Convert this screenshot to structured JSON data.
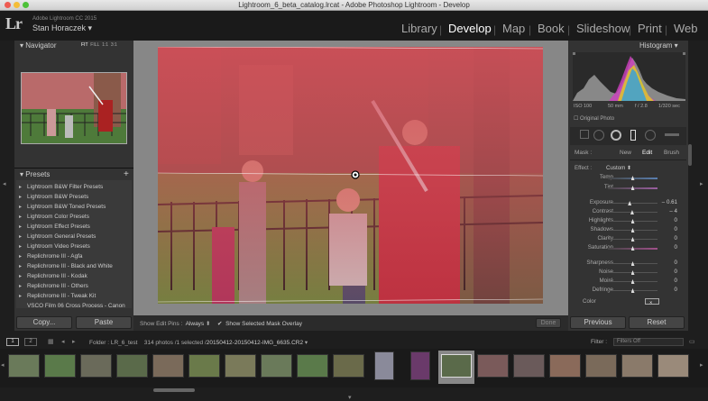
{
  "window": {
    "title": "Lightroom_6_beta_catalog.lrcat - Adobe Photoshop Lightroom - Develop"
  },
  "identity": {
    "app": "Adobe Lightroom CC 2015",
    "user": "Stan Horaczek",
    "logo": "Lr"
  },
  "modules": [
    "Library",
    "Develop",
    "Map",
    "Book",
    "Slideshow",
    "Print",
    "Web"
  ],
  "active_module": "Develop",
  "navigator": {
    "title": "Navigator",
    "zoom": [
      "FIT",
      "FILL",
      "1:1",
      "3:1"
    ]
  },
  "presets": {
    "title": "Presets",
    "add": "+",
    "items": [
      "Lightroom B&W Filter Presets",
      "Lightroom B&W Presets",
      "Lightroom B&W Toned Presets",
      "Lightroom Color Presets",
      "Lightroom Effect Presets",
      "Lightroom General Presets",
      "Lightroom Video Presets",
      "Replichrome III - Agfa",
      "Replichrome III - Black and White",
      "Replichrome III - Kodak",
      "Replichrome III - Others",
      "Replichrome III - Tweak Kit",
      "VSCO Film 06 Cross Process - Canon"
    ]
  },
  "left_buttons": {
    "copy": "Copy...",
    "paste": "Paste"
  },
  "histogram": {
    "title": "Histogram",
    "iso": "ISO 100",
    "focal": "50 mm",
    "aperture": "f / 2.8",
    "shutter": "1/320 sec",
    "original": "Original Photo"
  },
  "mask": {
    "label": "Mask :",
    "modes": [
      "New",
      "Edit",
      "Brush"
    ],
    "active": "Edit"
  },
  "effect": {
    "label": "Effect :",
    "value": "Custom"
  },
  "sliders": [
    {
      "label": "Temp",
      "value": "",
      "pos": 0.5,
      "color": "#5a7fb0"
    },
    {
      "label": "Tint",
      "value": "",
      "pos": 0.5,
      "color": "#9a5fa0"
    },
    {
      "label": "Exposure",
      "value": "– 0.61",
      "pos": 0.44
    },
    {
      "label": "Contrast",
      "value": "– 4",
      "pos": 0.49
    },
    {
      "label": "Highlights",
      "value": "0",
      "pos": 0.5
    },
    {
      "label": "Shadows",
      "value": "0",
      "pos": 0.5
    },
    {
      "label": "Clarity",
      "value": "0",
      "pos": 0.5
    },
    {
      "label": "Saturation",
      "value": "0",
      "pos": 0.5,
      "color": "#a0508a"
    },
    {
      "label": "Sharpness",
      "value": "0",
      "pos": 0.5
    },
    {
      "label": "Noise",
      "value": "0",
      "pos": 0.5
    },
    {
      "label": "Moiré",
      "value": "0",
      "pos": 0.5
    },
    {
      "label": "Defringe",
      "value": "0",
      "pos": 0.5
    }
  ],
  "color_label": "Color",
  "right_buttons": {
    "previous": "Previous",
    "reset": "Reset"
  },
  "toolbar": {
    "pins_label": "Show Edit Pins :",
    "pins_value": "Always",
    "overlay_label": "Show Selected Mask Overlay",
    "done": "Done"
  },
  "filmstrip_bar": {
    "page1": "1",
    "page2": "2",
    "folder": "Folder : LR_6_test",
    "count": "314 photos /1 selected /",
    "filename": "20150412-20150412-IMG_6635.CR2",
    "filter_label": "Filter :",
    "filter_value": "Filters Off"
  },
  "colors": {
    "accent": "#ffffff",
    "panel": "#333333",
    "mask_overlay": "#d2505a"
  }
}
